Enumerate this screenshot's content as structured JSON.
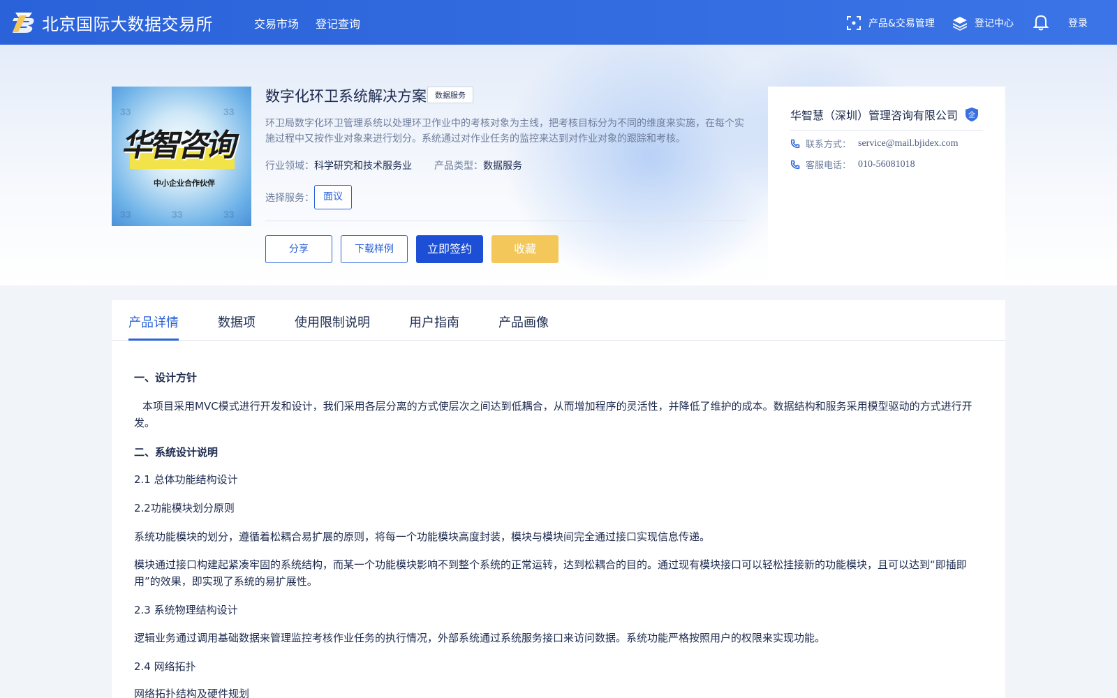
{
  "header": {
    "brand": "北京国际大数据交易所",
    "nav": [
      "交易市场",
      "登记查询"
    ],
    "product_mgmt": "产品&交易管理",
    "register_center": "登记中心",
    "login": "登录"
  },
  "product": {
    "title": "数字化环卫系统解决方案",
    "tag": "数据服务",
    "description": "环卫局数字化环卫管理系统以处理环卫作业中的考核对象为主线，把考核目标分为不同的维度来实施，在每个实施过程中又按作业对象来进行划分。系统通过对作业任务的监控来达到对作业对象的跟踪和考核。",
    "industry_label": "行业领域：",
    "industry": "科学研究和技术服务业",
    "type_label": "产品类型：",
    "type": "数据服务",
    "service_label": "选择服务：",
    "service_option": "面议",
    "image": {
      "title": "华智咨询",
      "subtitle": "中小企业合作伙伴",
      "watermark": "33"
    },
    "buttons": {
      "share": "分享",
      "download": "下载样例",
      "sign": "立即签约",
      "favorite": "收藏"
    }
  },
  "seller": {
    "name": "华智慧（深圳）管理咨询有限公司",
    "badge": "企",
    "contact_label": "联系方式：",
    "contact": "service@mail.bjidex.com",
    "phone_label": "客服电话：",
    "phone": "010-56081018"
  },
  "tabs": [
    "产品详情",
    "数据项",
    "使用限制说明",
    "用户指南",
    "产品画像"
  ],
  "content": {
    "h1": "一、设计方针",
    "p1": "本项目采用MVC模式进行开发和设计，我们采用各层分离的方式使层次之间达到低耦合，从而增加程序的灵活性，并降低了维护的成本。数据结构和服务采用模型驱动的方式进行开发。",
    "h2": "二、系统设计说明",
    "s21": "2.1 总体功能结构设计",
    "s22": "2.2功能模块划分原则",
    "p2": "系统功能模块的划分，遵循着松耦合易扩展的原则，将每一个功能模块高度封装，模块与模块间完全通过接口实现信息传递。",
    "p3": "模块通过接口构建起紧凑牢固的系统结构，而某一个功能模块影响不到整个系统的正常运转，达到松耦合的目的。通过现有模块接口可以轻松挂接新的功能模块，且可以达到“即插即用”的效果，即实现了系统的易扩展性。",
    "s23": "2.3 系统物理结构设计",
    "p4": "逻辑业务通过调用基础数据来管理监控考核作业任务的执行情况，外部系统通过系统服务接口来访问数据。系统功能严格按照用户的权限来实现功能。",
    "s24": "2.4 网络拓扑",
    "s25": "网络拓扑结构及硬件规划"
  },
  "colors": {
    "primary": "#2a62d9",
    "primary_dark": "#1d4fd6",
    "favorite": "#f3c75a",
    "text": "#1d2b4f",
    "muted": "#6e7d9c"
  }
}
